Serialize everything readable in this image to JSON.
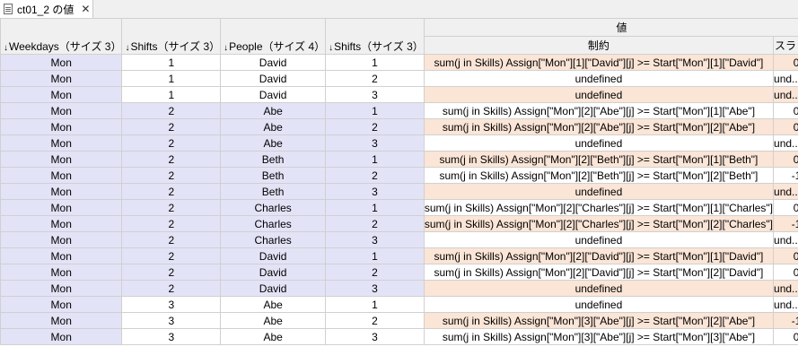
{
  "tab": {
    "title": "ct01_2 の値",
    "close_icon": "close-icon"
  },
  "header": {
    "col_weekdays": "Weekdays（サイズ 3）",
    "col_shifts": "Shifts（サイズ 3）",
    "col_people": "People（サイズ 4）",
    "col_pshifts": "Shifts（サイズ 3）",
    "group_value": "値",
    "col_constraint": "制約",
    "col_slack": "スラック",
    "sort_arrow": "↓"
  },
  "rows": [
    {
      "w": "Mon",
      "s": "1",
      "p": "David",
      "ps": "1",
      "c": "sum(j in Skills) Assign[\"Mon\"][1][\"David\"][j] >= Start[\"Mon\"][1][\"David\"]",
      "k": "0"
    },
    {
      "w": "Mon",
      "s": "1",
      "p": "David",
      "ps": "2",
      "c": "undefined",
      "k": "und...ned"
    },
    {
      "w": "Mon",
      "s": "1",
      "p": "David",
      "ps": "3",
      "c": "undefined",
      "k": "und...ned"
    },
    {
      "w": "Mon",
      "s": "2",
      "p": "Abe",
      "ps": "1",
      "c": "sum(j in Skills) Assign[\"Mon\"][2][\"Abe\"][j] >= Start[\"Mon\"][1][\"Abe\"]",
      "k": "0"
    },
    {
      "w": "Mon",
      "s": "2",
      "p": "Abe",
      "ps": "2",
      "c": "sum(j in Skills) Assign[\"Mon\"][2][\"Abe\"][j] >= Start[\"Mon\"][2][\"Abe\"]",
      "k": "0"
    },
    {
      "w": "Mon",
      "s": "2",
      "p": "Abe",
      "ps": "3",
      "c": "undefined",
      "k": "und...ned"
    },
    {
      "w": "Mon",
      "s": "2",
      "p": "Beth",
      "ps": "1",
      "c": "sum(j in Skills) Assign[\"Mon\"][2][\"Beth\"][j] >= Start[\"Mon\"][1][\"Beth\"]",
      "k": "0"
    },
    {
      "w": "Mon",
      "s": "2",
      "p": "Beth",
      "ps": "2",
      "c": "sum(j in Skills) Assign[\"Mon\"][2][\"Beth\"][j] >= Start[\"Mon\"][2][\"Beth\"]",
      "k": "-1"
    },
    {
      "w": "Mon",
      "s": "2",
      "p": "Beth",
      "ps": "3",
      "c": "undefined",
      "k": "und...ned"
    },
    {
      "w": "Mon",
      "s": "2",
      "p": "Charles",
      "ps": "1",
      "c": "sum(j in Skills) Assign[\"Mon\"][2][\"Charles\"][j] >= Start[\"Mon\"][1][\"Charles\"]",
      "k": "0"
    },
    {
      "w": "Mon",
      "s": "2",
      "p": "Charles",
      "ps": "2",
      "c": "sum(j in Skills) Assign[\"Mon\"][2][\"Charles\"][j] >= Start[\"Mon\"][2][\"Charles\"]",
      "k": "-1"
    },
    {
      "w": "Mon",
      "s": "2",
      "p": "Charles",
      "ps": "3",
      "c": "undefined",
      "k": "und...ned"
    },
    {
      "w": "Mon",
      "s": "2",
      "p": "David",
      "ps": "1",
      "c": "sum(j in Skills) Assign[\"Mon\"][2][\"David\"][j] >= Start[\"Mon\"][1][\"David\"]",
      "k": "0"
    },
    {
      "w": "Mon",
      "s": "2",
      "p": "David",
      "ps": "2",
      "c": "sum(j in Skills) Assign[\"Mon\"][2][\"David\"][j] >= Start[\"Mon\"][2][\"David\"]",
      "k": "0"
    },
    {
      "w": "Mon",
      "s": "2",
      "p": "David",
      "ps": "3",
      "c": "undefined",
      "k": "und...ned"
    },
    {
      "w": "Mon",
      "s": "3",
      "p": "Abe",
      "ps": "1",
      "c": "undefined",
      "k": "und...ned"
    },
    {
      "w": "Mon",
      "s": "3",
      "p": "Abe",
      "ps": "2",
      "c": "sum(j in Skills) Assign[\"Mon\"][3][\"Abe\"][j] >= Start[\"Mon\"][2][\"Abe\"]",
      "k": "-1"
    },
    {
      "w": "Mon",
      "s": "3",
      "p": "Abe",
      "ps": "3",
      "c": "sum(j in Skills) Assign[\"Mon\"][3][\"Abe\"][j] >= Start[\"Mon\"][3][\"Abe\"]",
      "k": "0"
    }
  ],
  "colors": {
    "index_bg": "#e3e3f7",
    "highlight_bg": "#fbe5d6",
    "header_bg": "#f0f0f0"
  }
}
